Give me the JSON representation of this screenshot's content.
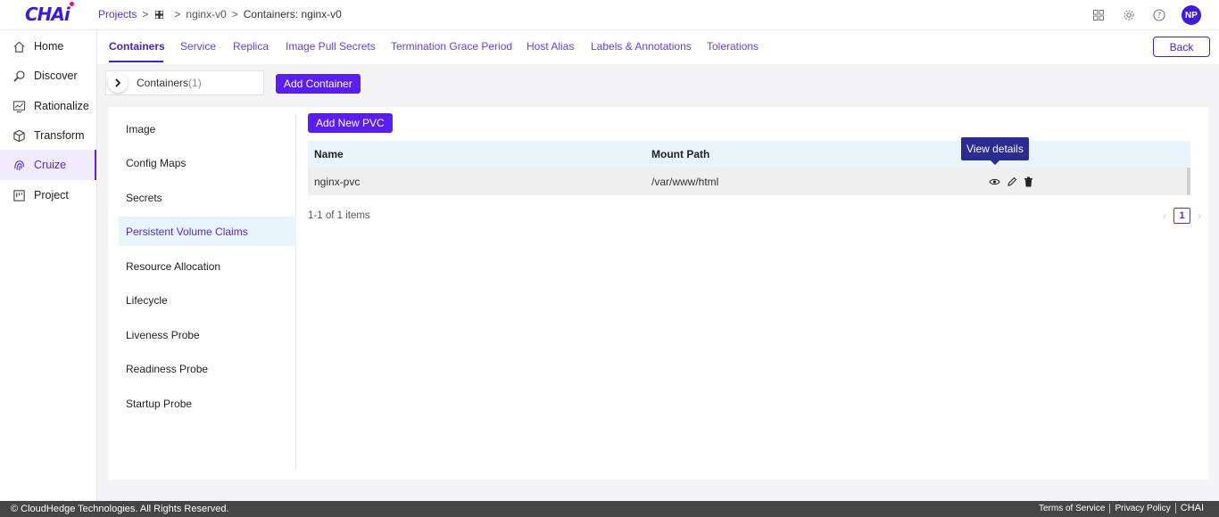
{
  "app": {
    "logo_text": "CHAi",
    "logo_colors": {
      "primary": "#3d1cd9",
      "dot": "#e3127a"
    }
  },
  "breadcrumb": {
    "projects": "Projects",
    "sep": ">",
    "app": "nginx-v0",
    "current": "Containers: nginx-v0"
  },
  "header": {
    "avatar_initials": "NP",
    "icons": [
      "apps-grid-icon",
      "gear-icon",
      "help-icon"
    ]
  },
  "sidebar": {
    "items": [
      {
        "label": "Home",
        "icon": "home-icon",
        "active": false
      },
      {
        "label": "Discover",
        "icon": "search-icon",
        "active": false
      },
      {
        "label": "Rationalize",
        "icon": "chart-icon",
        "active": false
      },
      {
        "label": "Transform",
        "icon": "cube-icon",
        "active": false
      },
      {
        "label": "Cruize",
        "icon": "fingerprint-icon",
        "active": true
      },
      {
        "label": "Project",
        "icon": "project-icon",
        "active": false
      }
    ]
  },
  "tabs": {
    "items": [
      {
        "label": "Containers",
        "active": true
      },
      {
        "label": "Service"
      },
      {
        "label": "Replica"
      },
      {
        "label": "Image Pull Secrets"
      },
      {
        "label": "Termination Grace Period"
      },
      {
        "label": "Host Alias"
      },
      {
        "label": "Labels & Annotations"
      },
      {
        "label": "Tolerations"
      }
    ],
    "back_label": "Back"
  },
  "containers": {
    "label": "Containers",
    "count": "(1)",
    "add_button": "Add Container"
  },
  "subnav": {
    "items": [
      {
        "label": "Image"
      },
      {
        "label": "Config Maps"
      },
      {
        "label": "Secrets"
      },
      {
        "label": "Persistent Volume Claims",
        "active": true
      },
      {
        "label": "Resource Allocation"
      },
      {
        "label": "Lifecycle"
      },
      {
        "label": "Liveness Probe"
      },
      {
        "label": "Readiness Probe"
      },
      {
        "label": "Startup Probe"
      }
    ]
  },
  "pvc": {
    "add_button": "Add New PVC",
    "columns": {
      "name": "Name",
      "mount_path": "Mount Path"
    },
    "rows": [
      {
        "name": "nginx-pvc",
        "mount_path": "/var/www/html"
      }
    ],
    "tooltip": "View details",
    "pager_text": "1-1 of 1 items",
    "current_page": "1"
  },
  "footer": {
    "copyright": "© CloudHedge Technologies. All Rights Reserved.",
    "terms": "Terms of Service",
    "privacy": "Privacy Policy",
    "brand": "CHAI"
  },
  "colors": {
    "accent": "#5a1ef0",
    "link": "#6a3fd8",
    "footer_bg": "#454545",
    "tooltip_bg": "#2a2d8f"
  }
}
